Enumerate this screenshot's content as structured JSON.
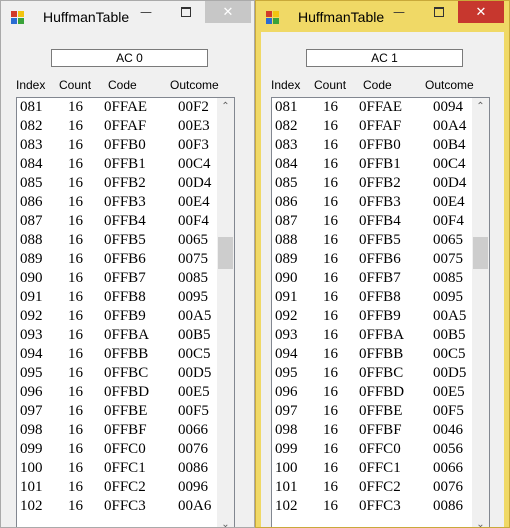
{
  "windows": [
    {
      "title": "HuffmanTable",
      "table_name": "AC 0",
      "minimize_glyph": "—",
      "close_glyph": "✕",
      "columns": {
        "index": "Index",
        "count": "Count",
        "code": "Code",
        "outcome": "Outcome"
      },
      "scroll_up": "⌃",
      "scroll_down": "⌄",
      "scroll_position": 0.33,
      "rows": [
        {
          "index": "081",
          "count": "16",
          "code": "0FFAE",
          "outcome": "00F2"
        },
        {
          "index": "082",
          "count": "16",
          "code": "0FFAF",
          "outcome": "00E3"
        },
        {
          "index": "083",
          "count": "16",
          "code": "0FFB0",
          "outcome": "00F3"
        },
        {
          "index": "084",
          "count": "16",
          "code": "0FFB1",
          "outcome": "00C4"
        },
        {
          "index": "085",
          "count": "16",
          "code": "0FFB2",
          "outcome": "00D4"
        },
        {
          "index": "086",
          "count": "16",
          "code": "0FFB3",
          "outcome": "00E4"
        },
        {
          "index": "087",
          "count": "16",
          "code": "0FFB4",
          "outcome": "00F4"
        },
        {
          "index": "088",
          "count": "16",
          "code": "0FFB5",
          "outcome": "0065"
        },
        {
          "index": "089",
          "count": "16",
          "code": "0FFB6",
          "outcome": "0075"
        },
        {
          "index": "090",
          "count": "16",
          "code": "0FFB7",
          "outcome": "0085"
        },
        {
          "index": "091",
          "count": "16",
          "code": "0FFB8",
          "outcome": "0095"
        },
        {
          "index": "092",
          "count": "16",
          "code": "0FFB9",
          "outcome": "00A5"
        },
        {
          "index": "093",
          "count": "16",
          "code": "0FFBA",
          "outcome": "00B5"
        },
        {
          "index": "094",
          "count": "16",
          "code": "0FFBB",
          "outcome": "00C5"
        },
        {
          "index": "095",
          "count": "16",
          "code": "0FFBC",
          "outcome": "00D5"
        },
        {
          "index": "096",
          "count": "16",
          "code": "0FFBD",
          "outcome": "00E5"
        },
        {
          "index": "097",
          "count": "16",
          "code": "0FFBE",
          "outcome": "00F5"
        },
        {
          "index": "098",
          "count": "16",
          "code": "0FFBF",
          "outcome": "0066"
        },
        {
          "index": "099",
          "count": "16",
          "code": "0FFC0",
          "outcome": "0076"
        },
        {
          "index": "100",
          "count": "16",
          "code": "0FFC1",
          "outcome": "0086"
        },
        {
          "index": "101",
          "count": "16",
          "code": "0FFC2",
          "outcome": "0096"
        },
        {
          "index": "102",
          "count": "16",
          "code": "0FFC3",
          "outcome": "00A6"
        }
      ]
    },
    {
      "title": "HuffmanTable",
      "table_name": "AC 1",
      "minimize_glyph": "—",
      "close_glyph": "✕",
      "columns": {
        "index": "Index",
        "count": "Count",
        "code": "Code",
        "outcome": "Outcome"
      },
      "scroll_up": "⌃",
      "scroll_down": "⌄",
      "scroll_position": 0.33,
      "rows": [
        {
          "index": "081",
          "count": "16",
          "code": "0FFAE",
          "outcome": "0094"
        },
        {
          "index": "082",
          "count": "16",
          "code": "0FFAF",
          "outcome": "00A4"
        },
        {
          "index": "083",
          "count": "16",
          "code": "0FFB0",
          "outcome": "00B4"
        },
        {
          "index": "084",
          "count": "16",
          "code": "0FFB1",
          "outcome": "00C4"
        },
        {
          "index": "085",
          "count": "16",
          "code": "0FFB2",
          "outcome": "00D4"
        },
        {
          "index": "086",
          "count": "16",
          "code": "0FFB3",
          "outcome": "00E4"
        },
        {
          "index": "087",
          "count": "16",
          "code": "0FFB4",
          "outcome": "00F4"
        },
        {
          "index": "088",
          "count": "16",
          "code": "0FFB5",
          "outcome": "0065"
        },
        {
          "index": "089",
          "count": "16",
          "code": "0FFB6",
          "outcome": "0075"
        },
        {
          "index": "090",
          "count": "16",
          "code": "0FFB7",
          "outcome": "0085"
        },
        {
          "index": "091",
          "count": "16",
          "code": "0FFB8",
          "outcome": "0095"
        },
        {
          "index": "092",
          "count": "16",
          "code": "0FFB9",
          "outcome": "00A5"
        },
        {
          "index": "093",
          "count": "16",
          "code": "0FFBA",
          "outcome": "00B5"
        },
        {
          "index": "094",
          "count": "16",
          "code": "0FFBB",
          "outcome": "00C5"
        },
        {
          "index": "095",
          "count": "16",
          "code": "0FFBC",
          "outcome": "00D5"
        },
        {
          "index": "096",
          "count": "16",
          "code": "0FFBD",
          "outcome": "00E5"
        },
        {
          "index": "097",
          "count": "16",
          "code": "0FFBE",
          "outcome": "00F5"
        },
        {
          "index": "098",
          "count": "16",
          "code": "0FFBF",
          "outcome": "0046"
        },
        {
          "index": "099",
          "count": "16",
          "code": "0FFC0",
          "outcome": "0056"
        },
        {
          "index": "100",
          "count": "16",
          "code": "0FFC1",
          "outcome": "0066"
        },
        {
          "index": "101",
          "count": "16",
          "code": "0FFC2",
          "outcome": "0076"
        },
        {
          "index": "102",
          "count": "16",
          "code": "0FFC3",
          "outcome": "0086"
        }
      ]
    }
  ],
  "colors": {
    "active_frame": "#f0d966",
    "inactive_frame": "#f0f0f0",
    "close_active": "#c7372e",
    "close_inactive": "#c7c7c7"
  }
}
